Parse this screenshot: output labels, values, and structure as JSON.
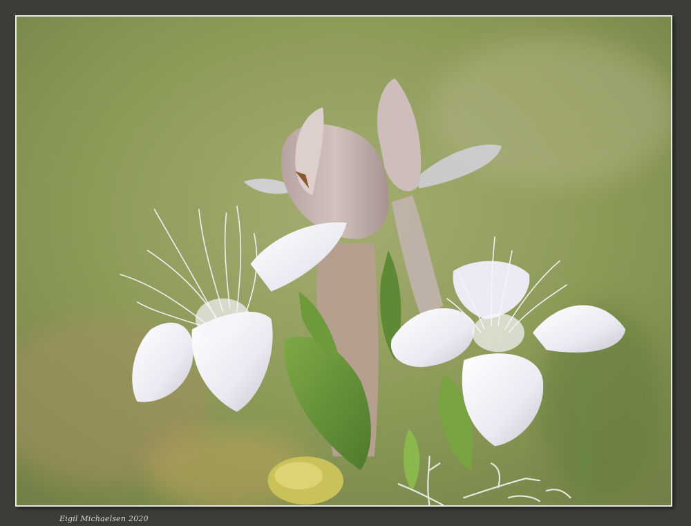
{
  "photo": {
    "subject": "white fringed gentian flowers",
    "colors": {
      "mat": "#3d3d37",
      "border": "#e9e9e4",
      "background_green": "#8e9f5a",
      "petal": "#f1f0f7",
      "bud": "#c4b0ae",
      "sepal": "#6e9a3c"
    }
  },
  "signature": {
    "text": "Eigil Michaelsen  2020"
  }
}
